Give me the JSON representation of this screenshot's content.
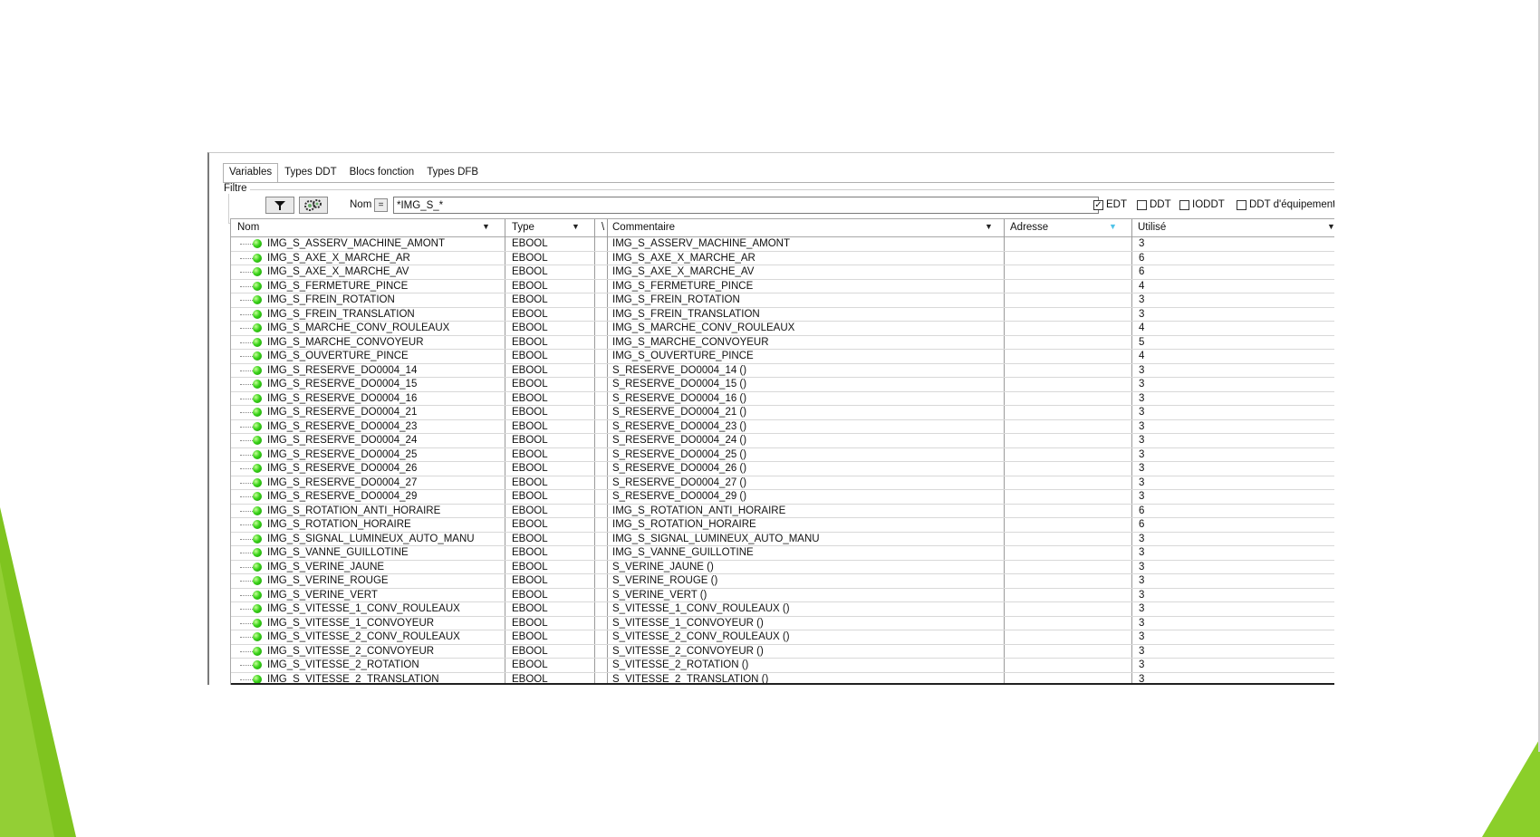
{
  "tabs": [
    "Variables",
    "Types DDT",
    "Blocs fonction",
    "Types DFB"
  ],
  "filter": {
    "legend": "Filtre",
    "filter_icon": "funnel-icon",
    "config_icon": "gears-icon",
    "name_label": "Nom",
    "eq_label": "=",
    "value": "*IMG_S_*",
    "checkboxes": [
      {
        "label": "EDT",
        "checked": true
      },
      {
        "label": "DDT",
        "checked": false
      },
      {
        "label": "IODDT",
        "checked": false
      },
      {
        "label": "DDT d'équipement",
        "checked": false
      }
    ]
  },
  "columns": {
    "nom": "Nom",
    "type": "Type",
    "sep": "\\",
    "commentaire": "Commentaire",
    "adresse": "Adresse",
    "utilise": "Utilisé"
  },
  "rows": [
    {
      "nom": "IMG_S_ASSERV_MACHINE_AMONT",
      "type": "EBOOL",
      "commentaire": "IMG_S_ASSERV_MACHINE_AMONT",
      "adresse": "",
      "utilise": "3"
    },
    {
      "nom": "IMG_S_AXE_X_MARCHE_AR",
      "type": "EBOOL",
      "commentaire": "IMG_S_AXE_X_MARCHE_AR",
      "adresse": "",
      "utilise": "6"
    },
    {
      "nom": "IMG_S_AXE_X_MARCHE_AV",
      "type": "EBOOL",
      "commentaire": "IMG_S_AXE_X_MARCHE_AV",
      "adresse": "",
      "utilise": "6"
    },
    {
      "nom": "IMG_S_FERMETURE_PINCE",
      "type": "EBOOL",
      "commentaire": "IMG_S_FERMETURE_PINCE",
      "adresse": "",
      "utilise": "4"
    },
    {
      "nom": "IMG_S_FREIN_ROTATION",
      "type": "EBOOL",
      "commentaire": "IMG_S_FREIN_ROTATION",
      "adresse": "",
      "utilise": "3"
    },
    {
      "nom": "IMG_S_FREIN_TRANSLATION",
      "type": "EBOOL",
      "commentaire": "IMG_S_FREIN_TRANSLATION",
      "adresse": "",
      "utilise": "3"
    },
    {
      "nom": "IMG_S_MARCHE_CONV_ROULEAUX",
      "type": "EBOOL",
      "commentaire": "IMG_S_MARCHE_CONV_ROULEAUX",
      "adresse": "",
      "utilise": "4"
    },
    {
      "nom": "IMG_S_MARCHE_CONVOYEUR",
      "type": "EBOOL",
      "commentaire": "IMG_S_MARCHE_CONVOYEUR",
      "adresse": "",
      "utilise": "5"
    },
    {
      "nom": "IMG_S_OUVERTURE_PINCE",
      "type": "EBOOL",
      "commentaire": "IMG_S_OUVERTURE_PINCE",
      "adresse": "",
      "utilise": "4"
    },
    {
      "nom": "IMG_S_RESERVE_DO0004_14",
      "type": "EBOOL",
      "commentaire": "S_RESERVE_DO0004_14 ()",
      "adresse": "",
      "utilise": "3"
    },
    {
      "nom": "IMG_S_RESERVE_DO0004_15",
      "type": "EBOOL",
      "commentaire": "S_RESERVE_DO0004_15 ()",
      "adresse": "",
      "utilise": "3"
    },
    {
      "nom": "IMG_S_RESERVE_DO0004_16",
      "type": "EBOOL",
      "commentaire": "S_RESERVE_DO0004_16 ()",
      "adresse": "",
      "utilise": "3"
    },
    {
      "nom": "IMG_S_RESERVE_DO0004_21",
      "type": "EBOOL",
      "commentaire": "S_RESERVE_DO0004_21 ()",
      "adresse": "",
      "utilise": "3"
    },
    {
      "nom": "IMG_S_RESERVE_DO0004_23",
      "type": "EBOOL",
      "commentaire": "S_RESERVE_DO0004_23 ()",
      "adresse": "",
      "utilise": "3"
    },
    {
      "nom": "IMG_S_RESERVE_DO0004_24",
      "type": "EBOOL",
      "commentaire": "S_RESERVE_DO0004_24 ()",
      "adresse": "",
      "utilise": "3"
    },
    {
      "nom": "IMG_S_RESERVE_DO0004_25",
      "type": "EBOOL",
      "commentaire": "S_RESERVE_DO0004_25 ()",
      "adresse": "",
      "utilise": "3"
    },
    {
      "nom": "IMG_S_RESERVE_DO0004_26",
      "type": "EBOOL",
      "commentaire": "S_RESERVE_DO0004_26 ()",
      "adresse": "",
      "utilise": "3"
    },
    {
      "nom": "IMG_S_RESERVE_DO0004_27",
      "type": "EBOOL",
      "commentaire": "S_RESERVE_DO0004_27 ()",
      "adresse": "",
      "utilise": "3"
    },
    {
      "nom": "IMG_S_RESERVE_DO0004_29",
      "type": "EBOOL",
      "commentaire": "S_RESERVE_DO0004_29 ()",
      "adresse": "",
      "utilise": "3"
    },
    {
      "nom": "IMG_S_ROTATION_ANTI_HORAIRE",
      "type": "EBOOL",
      "commentaire": "IMG_S_ROTATION_ANTI_HORAIRE",
      "adresse": "",
      "utilise": "6"
    },
    {
      "nom": "IMG_S_ROTATION_HORAIRE",
      "type": "EBOOL",
      "commentaire": "IMG_S_ROTATION_HORAIRE",
      "adresse": "",
      "utilise": "6"
    },
    {
      "nom": "IMG_S_SIGNAL_LUMINEUX_AUTO_MANU",
      "type": "EBOOL",
      "commentaire": "IMG_S_SIGNAL_LUMINEUX_AUTO_MANU",
      "adresse": "",
      "utilise": "3"
    },
    {
      "nom": "IMG_S_VANNE_GUILLOTINE",
      "type": "EBOOL",
      "commentaire": "IMG_S_VANNE_GUILLOTINE",
      "adresse": "",
      "utilise": "3"
    },
    {
      "nom": "IMG_S_VERINE_JAUNE",
      "type": "EBOOL",
      "commentaire": "S_VERINE_JAUNE ()",
      "adresse": "",
      "utilise": "3"
    },
    {
      "nom": "IMG_S_VERINE_ROUGE",
      "type": "EBOOL",
      "commentaire": "S_VERINE_ROUGE ()",
      "adresse": "",
      "utilise": "3"
    },
    {
      "nom": "IMG_S_VERINE_VERT",
      "type": "EBOOL",
      "commentaire": "S_VERINE_VERT ()",
      "adresse": "",
      "utilise": "3"
    },
    {
      "nom": "IMG_S_VITESSE_1_CONV_ROULEAUX",
      "type": "EBOOL",
      "commentaire": "S_VITESSE_1_CONV_ROULEAUX ()",
      "adresse": "",
      "utilise": "3"
    },
    {
      "nom": "IMG_S_VITESSE_1_CONVOYEUR",
      "type": "EBOOL",
      "commentaire": "S_VITESSE_1_CONVOYEUR ()",
      "adresse": "",
      "utilise": "3"
    },
    {
      "nom": "IMG_S_VITESSE_2_CONV_ROULEAUX",
      "type": "EBOOL",
      "commentaire": "S_VITESSE_2_CONV_ROULEAUX ()",
      "adresse": "",
      "utilise": "3"
    },
    {
      "nom": "IMG_S_VITESSE_2_CONVOYEUR",
      "type": "EBOOL",
      "commentaire": "S_VITESSE_2_CONVOYEUR ()",
      "adresse": "",
      "utilise": "3"
    },
    {
      "nom": "IMG_S_VITESSE_2_ROTATION",
      "type": "EBOOL",
      "commentaire": "S_VITESSE_2_ROTATION ()",
      "adresse": "",
      "utilise": "3"
    },
    {
      "nom": "IMG_S_VITESSE_2_TRANSLATION",
      "type": "EBOOL",
      "commentaire": "S_VITESSE_2_TRANSLATION ()",
      "adresse": "",
      "utilise": "3"
    }
  ],
  "colors": {
    "accent_green": "#8bcf2a",
    "led_green": "#3bd41b",
    "sort_arrow": "#4fc3e8"
  }
}
